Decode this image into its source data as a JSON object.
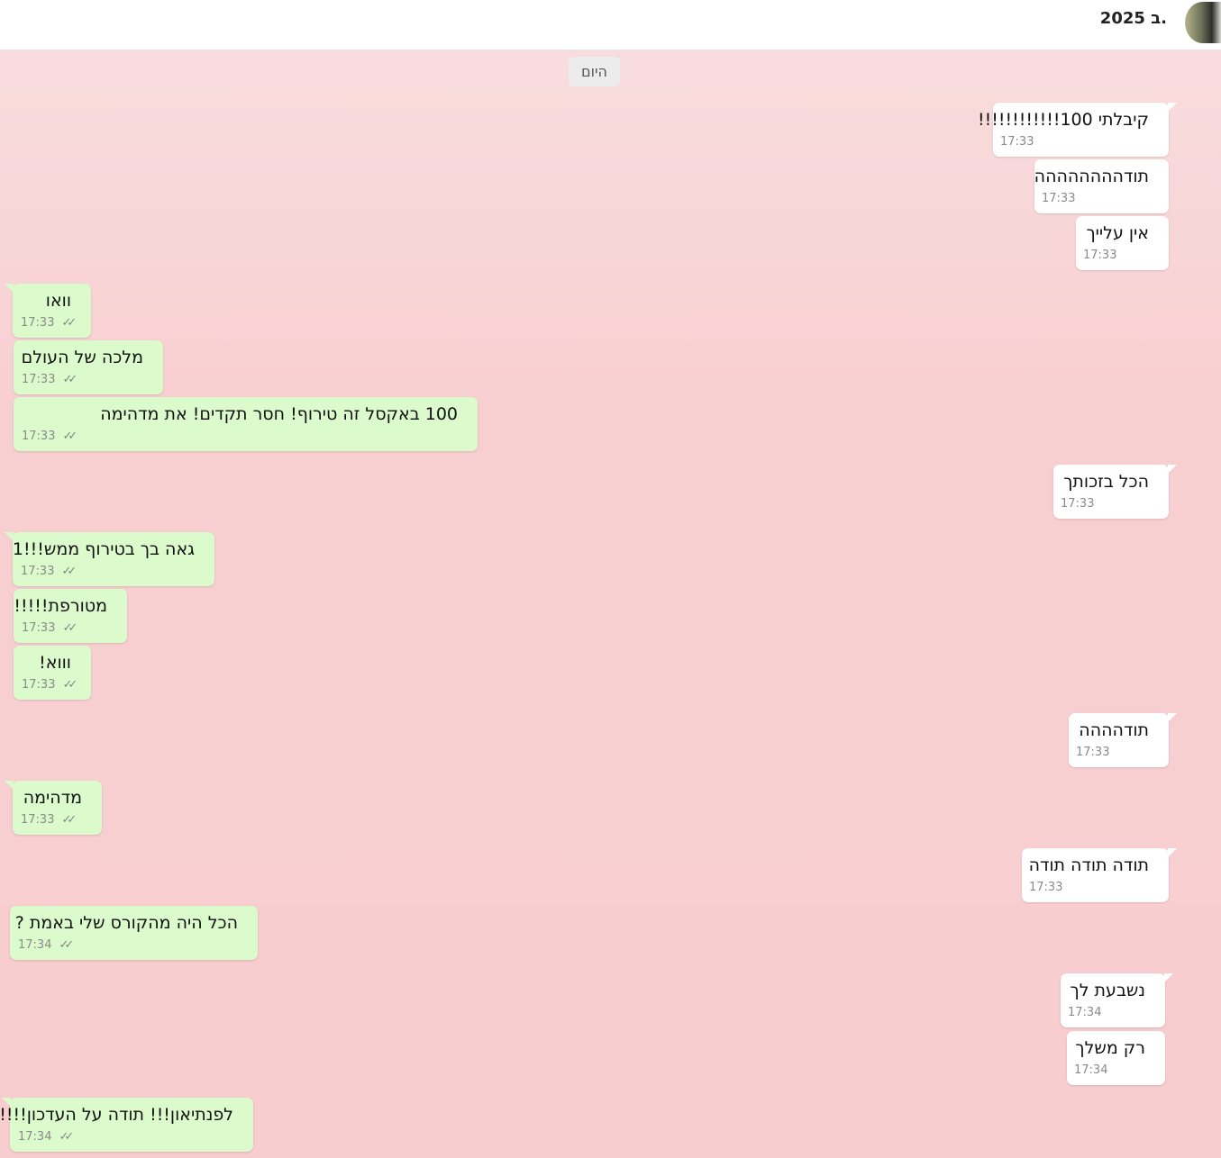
{
  "header": {
    "title": ".ב 2025"
  },
  "day_separator": "היום",
  "messages": [
    {
      "dir": "in",
      "text": "קיבלתי 100!!!!!!!!!!!!",
      "time": "17:33"
    },
    {
      "dir": "in",
      "text": "תודהההההההה",
      "time": "17:33"
    },
    {
      "dir": "in",
      "text": "אין עלייך",
      "time": "17:33"
    },
    {
      "dir": "out",
      "text": "וואו",
      "time": "17:33"
    },
    {
      "dir": "out",
      "text": "מלכה של העולם",
      "time": "17:33"
    },
    {
      "dir": "out",
      "text": "100 באקסל זה טירוף! חסר תקדים! את מדהימה",
      "time": "17:33"
    },
    {
      "dir": "in",
      "text": "הכל בזכותך",
      "time": "17:33"
    },
    {
      "dir": "out",
      "text": "גאה בך בטירוף ממש!!!1",
      "time": "17:33"
    },
    {
      "dir": "out",
      "text": "מטורפת!!!!!",
      "time": "17:33"
    },
    {
      "dir": "out",
      "text": "וווא!",
      "time": "17:33"
    },
    {
      "dir": "in",
      "text": "תודהההה",
      "time": "17:33"
    },
    {
      "dir": "out",
      "text": "מדהימה",
      "time": "17:33"
    },
    {
      "dir": "in",
      "text": "תודה תודה תודה",
      "time": "17:33"
    },
    {
      "dir": "out",
      "text": "הכל היה מהקורס שלי באמת ?",
      "time": "17:34"
    },
    {
      "dir": "in",
      "text": "נשבעת לך",
      "time": "17:34"
    },
    {
      "dir": "in",
      "text": "רק משלך",
      "time": "17:34"
    },
    {
      "dir": "out",
      "text": "לפנתיאון!!! תודה על העדכון!!!!",
      "time": "17:34"
    }
  ]
}
